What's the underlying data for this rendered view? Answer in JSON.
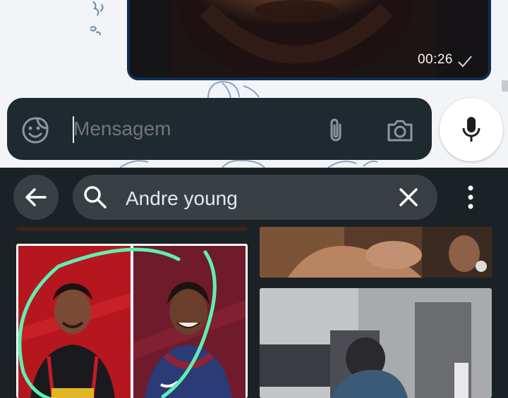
{
  "video": {
    "duration": "00:26"
  },
  "composer": {
    "placeholder": "Mensagem",
    "emoji_icon": "sticker-face-icon",
    "attach_icon": "paperclip-icon",
    "camera_icon": "camera-icon",
    "mic_icon": "microphone-icon"
  },
  "gif_search": {
    "query": "Andre young",
    "back_icon": "arrow-left-icon",
    "search_icon": "search-icon",
    "clear_icon": "close-icon",
    "more_icon": "more-vertical-icon"
  },
  "results": [
    {
      "badge": ""
    },
    {
      "badge": ""
    },
    {
      "badge": ""
    },
    {
      "badge": ""
    }
  ],
  "colors": {
    "bubble_border": "#0f2e52",
    "composer_bg": "#1f2a30",
    "panel_bg": "#1b2226",
    "search_bg": "#384046",
    "highlight_circle": "#5ef0b0"
  }
}
